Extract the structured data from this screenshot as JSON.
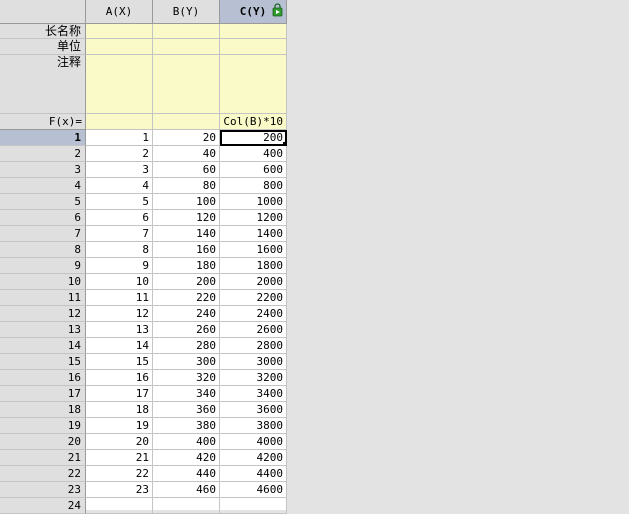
{
  "columns": [
    {
      "header": "A(X)",
      "long_name": "",
      "unit": "",
      "comment": "",
      "formula": ""
    },
    {
      "header": "B(Y)",
      "long_name": "",
      "unit": "",
      "comment": "",
      "formula": ""
    },
    {
      "header": "C(Y)",
      "long_name": "",
      "unit": "",
      "comment": "",
      "formula": "Col(B)*10"
    }
  ],
  "meta_labels": {
    "long_name": "长名称",
    "unit": "单位",
    "comment": "注释",
    "formula": "F(x)="
  },
  "selected_column": "C(Y)",
  "active_cell": {
    "row": 1,
    "column": "C(Y)"
  },
  "column_c_icon": "lock-recalculate-icon",
  "colors": {
    "metadata_bg": "#fafac8",
    "header_bg": "#dfdfdf",
    "selected_header_bg": "#b7c0d2"
  },
  "rows": [
    {
      "n": "1",
      "a": "1",
      "b": "20",
      "c": "200"
    },
    {
      "n": "2",
      "a": "2",
      "b": "40",
      "c": "400"
    },
    {
      "n": "3",
      "a": "3",
      "b": "60",
      "c": "600"
    },
    {
      "n": "4",
      "a": "4",
      "b": "80",
      "c": "800"
    },
    {
      "n": "5",
      "a": "5",
      "b": "100",
      "c": "1000"
    },
    {
      "n": "6",
      "a": "6",
      "b": "120",
      "c": "1200"
    },
    {
      "n": "7",
      "a": "7",
      "b": "140",
      "c": "1400"
    },
    {
      "n": "8",
      "a": "8",
      "b": "160",
      "c": "1600"
    },
    {
      "n": "9",
      "a": "9",
      "b": "180",
      "c": "1800"
    },
    {
      "n": "10",
      "a": "10",
      "b": "200",
      "c": "2000"
    },
    {
      "n": "11",
      "a": "11",
      "b": "220",
      "c": "2200"
    },
    {
      "n": "12",
      "a": "12",
      "b": "240",
      "c": "2400"
    },
    {
      "n": "13",
      "a": "13",
      "b": "260",
      "c": "2600"
    },
    {
      "n": "14",
      "a": "14",
      "b": "280",
      "c": "2800"
    },
    {
      "n": "15",
      "a": "15",
      "b": "300",
      "c": "3000"
    },
    {
      "n": "16",
      "a": "16",
      "b": "320",
      "c": "3200"
    },
    {
      "n": "17",
      "a": "17",
      "b": "340",
      "c": "3400"
    },
    {
      "n": "18",
      "a": "18",
      "b": "360",
      "c": "3600"
    },
    {
      "n": "19",
      "a": "19",
      "b": "380",
      "c": "3800"
    },
    {
      "n": "20",
      "a": "20",
      "b": "400",
      "c": "4000"
    },
    {
      "n": "21",
      "a": "21",
      "b": "420",
      "c": "4200"
    },
    {
      "n": "22",
      "a": "22",
      "b": "440",
      "c": "4400"
    },
    {
      "n": "23",
      "a": "23",
      "b": "460",
      "c": "4600"
    },
    {
      "n": "24",
      "a": "",
      "b": "",
      "c": ""
    }
  ]
}
